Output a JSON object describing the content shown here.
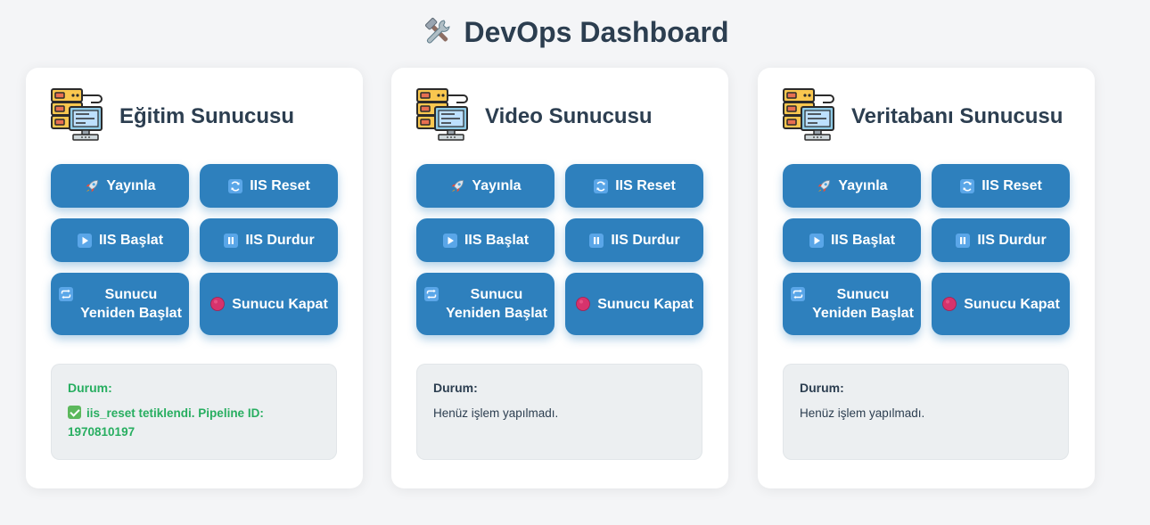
{
  "header": {
    "title": "DevOps Dashboard",
    "icon": "hammer-and-wrench-icon"
  },
  "buttons": {
    "publish": "Yayınla",
    "iis_reset": "IIS Reset",
    "iis_start": "IIS Başlat",
    "iis_stop": "IIS Durdur",
    "restart": "Sunucu Yeniden Başlat",
    "shutdown": "Sunucu Kapat"
  },
  "button_icons": {
    "publish": "rocket-icon",
    "iis_reset": "refresh-icon",
    "iis_start": "play-icon",
    "iis_stop": "pause-icon",
    "restart": "repeat-icon",
    "shutdown": "red-circle-icon"
  },
  "status_label": "Durum:",
  "servers": [
    {
      "name": "Eğitim Sunucusu",
      "status": "iis_reset tetiklendi. Pipeline ID: 1970810197",
      "status_type": "success"
    },
    {
      "name": "Video Sunucusu",
      "status": "Henüz işlem yapılmadı.",
      "status_type": "idle"
    },
    {
      "name": "Veritabanı Sunucusu",
      "status": "Henüz işlem yapılmadı.",
      "status_type": "idle"
    }
  ],
  "colors": {
    "background": "#f4f5f7",
    "button": "#2e80bd",
    "title_text": "#2c3e50",
    "success_text": "#27ae60",
    "status_box": "#eceff1"
  }
}
